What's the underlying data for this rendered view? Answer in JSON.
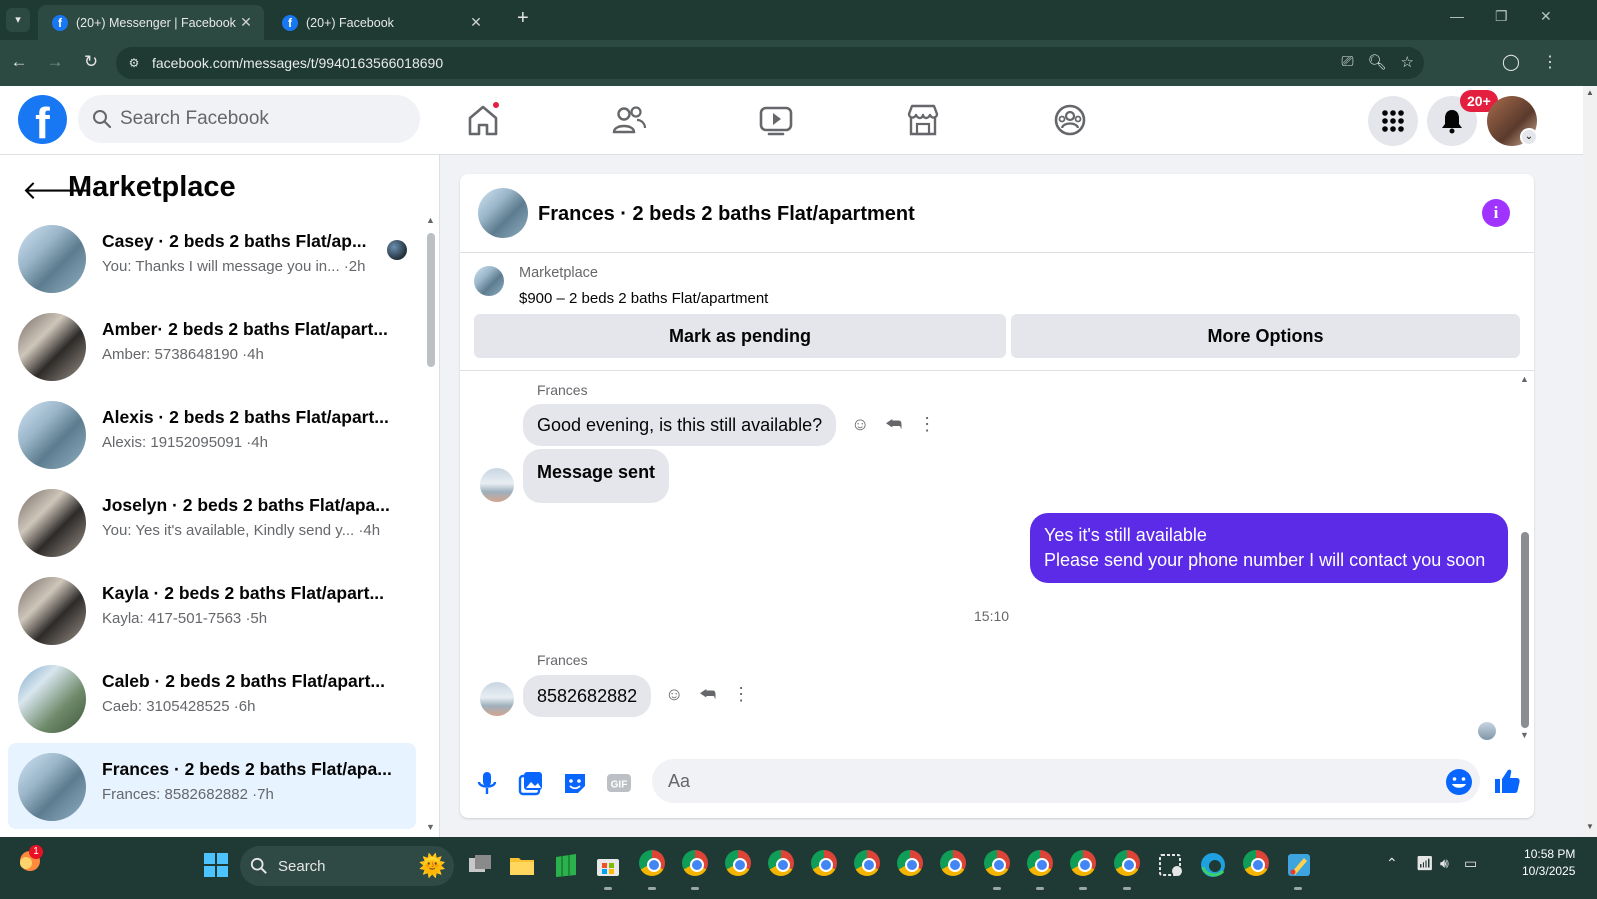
{
  "browser": {
    "tabs": [
      {
        "title": "(20+) Messenger | Facebook",
        "active": true
      },
      {
        "title": "(20+) Facebook",
        "active": false
      }
    ],
    "url": "facebook.com/messages/t/9940163566018690"
  },
  "header": {
    "search_placeholder": "Search Facebook",
    "notification_badge": "20+",
    "nav_icons": [
      "home-icon",
      "friends-icon",
      "video-icon",
      "marketplace-icon",
      "groups-icon"
    ]
  },
  "sidebar": {
    "title": "Marketplace",
    "conversations": [
      {
        "name": "Casey · 2 beds 2 baths Flat/ap...",
        "preview": "You: Thanks I will message you in... ·2h"
      },
      {
        "name": "Amber· 2 beds 2 baths Flat/apart...",
        "preview": "Amber: 5738648190 ·4h"
      },
      {
        "name": "Alexis · 2 beds 2 baths Flat/apart...",
        "preview": "Alexis: 19152095091 ·4h"
      },
      {
        "name": "Joselyn · 2 beds 2 baths Flat/apa...",
        "preview": "You: Yes it's available, Kindly send y...  ·4h"
      },
      {
        "name": "Kayla · 2 beds 2 baths Flat/apart...",
        "preview": "Kayla: 417-501-7563 ·5h"
      },
      {
        "name": "Caleb · 2 beds 2 baths Flat/apart...",
        "preview": "Caeb: 3105428525 ·6h"
      },
      {
        "name": "Frances · 2 beds 2 baths Flat/apa...",
        "preview": "Frances: 8582682882 ·7h"
      }
    ]
  },
  "chat": {
    "title": "Frances · 2 beds 2 baths Flat/apartment",
    "marketplace_label": "Marketplace",
    "listing": "$900 – 2 beds 2 baths Flat/apartment",
    "mark_pending": "Mark as pending",
    "more_options": "More Options",
    "messages": {
      "sender1": "Frances",
      "msg1": "Good evening, is this still available?",
      "msg2": "Message sent",
      "out1": "Yes it's still available",
      "out2": "Please send your phone number I will contact you soon",
      "time": "15:10",
      "sender2": "Frances",
      "msg3": "8582682882"
    },
    "composer_placeholder": "Aa"
  },
  "taskbar": {
    "search_label": "Search",
    "notification_count": "1",
    "time": "10:58 PM",
    "date": "10/3/2025"
  },
  "colors": {
    "facebook_blue": "#1877f2",
    "outgoing_bubble": "#5b2be8",
    "info_purple": "#a033ff",
    "badge_red": "#e41e3f"
  }
}
